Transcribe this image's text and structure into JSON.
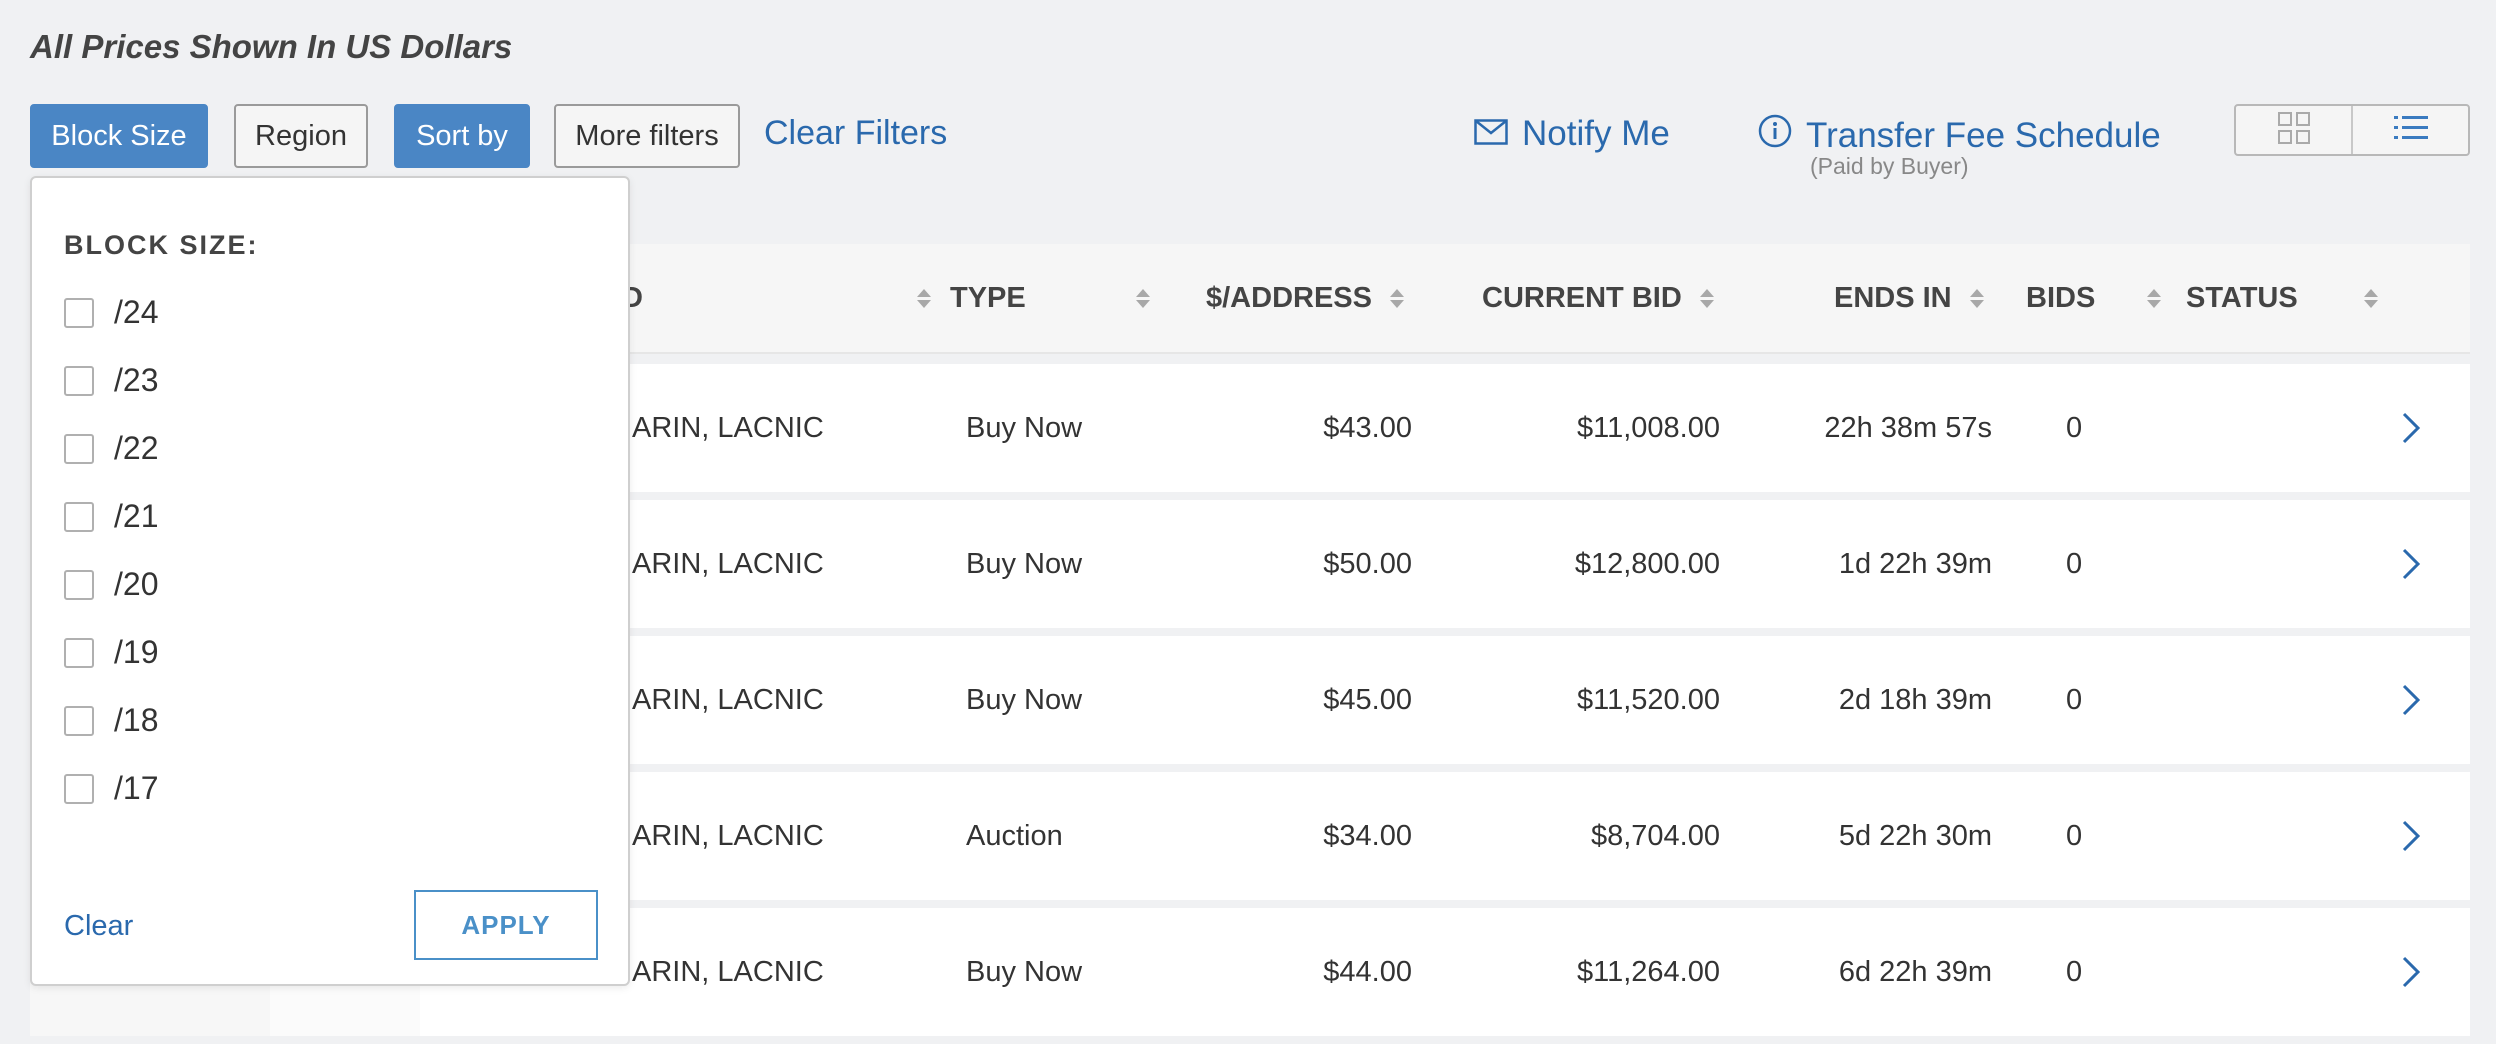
{
  "notice": "All Prices Shown In US Dollars",
  "filters": {
    "block_size": "Block Size",
    "region": "Region",
    "sort_by": "Sort by",
    "more_filters": "More filters",
    "clear_filters": "Clear Filters"
  },
  "notify_me": "Notify Me",
  "transfer_fee": {
    "label": "Transfer Fee Schedule",
    "sub": "(Paid by Buyer)"
  },
  "view_toggle": {
    "grid_icon": "grid-icon",
    "list_icon": "list-icon"
  },
  "table": {
    "headers": {
      "registry_partial": "D",
      "type": "TYPE",
      "per_address": "$/ADDRESS",
      "current_bid": "CURRENT BID",
      "ends_in": "ENDS IN",
      "bids": "BIDS",
      "status": "STATUS"
    },
    "rows": [
      {
        "registry": "ARIN, LACNIC",
        "type": "Buy Now",
        "per_address": "$43.00",
        "current_bid": "$11,008.00",
        "ends_in": "22h 38m 57s",
        "bids": "0",
        "status": ""
      },
      {
        "registry": "ARIN, LACNIC",
        "type": "Buy Now",
        "per_address": "$50.00",
        "current_bid": "$12,800.00",
        "ends_in": "1d 22h 39m",
        "bids": "0",
        "status": ""
      },
      {
        "registry": "ARIN, LACNIC",
        "type": "Buy Now",
        "per_address": "$45.00",
        "current_bid": "$11,520.00",
        "ends_in": "2d 18h 39m",
        "bids": "0",
        "status": ""
      },
      {
        "registry": "ARIN, LACNIC",
        "type": "Auction",
        "per_address": "$34.00",
        "current_bid": "$8,704.00",
        "ends_in": "5d 22h 30m",
        "bids": "0",
        "status": ""
      },
      {
        "registry": "ARIN, LACNIC",
        "type": "Buy Now",
        "per_address": "$44.00",
        "current_bid": "$11,264.00",
        "ends_in": "6d 22h 39m",
        "bids": "0",
        "status": ""
      }
    ]
  },
  "dropdown": {
    "title": "BLOCK SIZE:",
    "options": [
      "/24",
      "/23",
      "/22",
      "/21",
      "/20",
      "/19",
      "/18",
      "/17"
    ],
    "clear": "Clear",
    "apply": "APPLY"
  },
  "colors": {
    "accent": "#4a86c5",
    "link": "#2a69ad",
    "background": "#f0f1f3"
  }
}
